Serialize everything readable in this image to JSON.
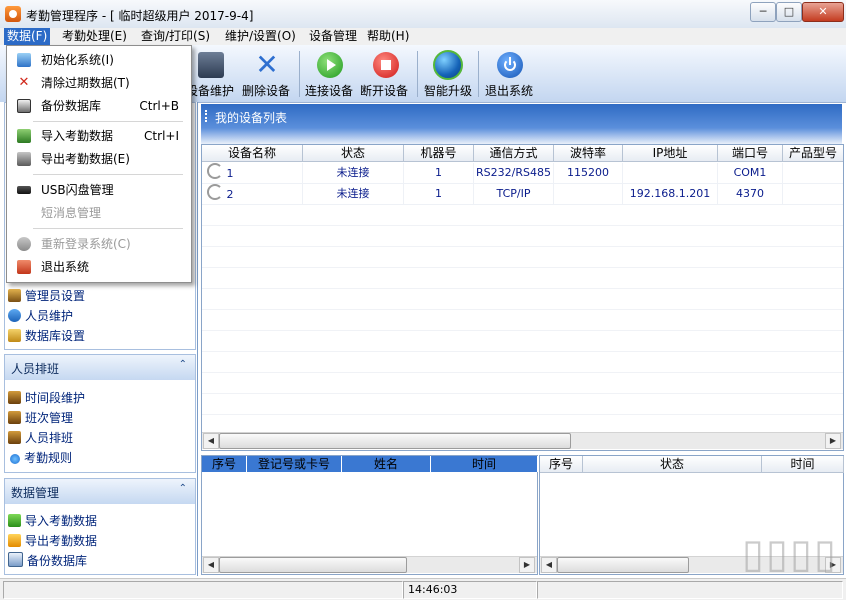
{
  "window": {
    "title": "考勤管理程序 - [ 临时超级用户 2017-9-4]",
    "min_label": "─",
    "max_label": "□",
    "close_label": "✕"
  },
  "menubar": [
    {
      "label": "数据(F)",
      "active": true
    },
    {
      "label": "考勤处理(E)"
    },
    {
      "label": "查询/打印(S)"
    },
    {
      "label": "维护/设置(O)"
    },
    {
      "label": "设备管理"
    },
    {
      "label": "帮助(H)"
    }
  ],
  "toolbar": {
    "buttons": [
      {
        "label": "设备维护",
        "icon": "device-maintenance-icon"
      },
      {
        "label": "删除设备",
        "icon": "delete-x-icon"
      },
      {
        "label": "连接设备",
        "icon": "connect-play-icon"
      },
      {
        "label": "断开设备",
        "icon": "disconnect-stop-icon"
      },
      {
        "label": "智能升级",
        "icon": "globe-upgrade-icon"
      },
      {
        "label": "退出系统",
        "icon": "power-icon"
      }
    ]
  },
  "dropdown": {
    "items": [
      {
        "label": "初始化系统(I)",
        "shortcut": "",
        "icon": "house-icon",
        "disabled": false
      },
      {
        "label": "清除过期数据(T)",
        "shortcut": "",
        "icon": "red-x-icon",
        "disabled": false
      },
      {
        "label": "备份数据库",
        "shortcut": "Ctrl+B",
        "icon": "backup-db-icon",
        "disabled": false
      },
      {
        "label": "导入考勤数据",
        "shortcut": "Ctrl+I",
        "icon": "import-icon",
        "disabled": false
      },
      {
        "label": "导出考勤数据(E)",
        "shortcut": "",
        "icon": "export-icon",
        "disabled": false
      },
      {
        "label": "USB闪盘管理",
        "shortcut": "",
        "icon": "usb-icon",
        "disabled": false
      },
      {
        "label": "短消息管理",
        "shortcut": "",
        "icon": "",
        "disabled": true
      },
      {
        "label": "重新登录系统(C)",
        "shortcut": "",
        "icon": "relogin-icon",
        "disabled": true
      },
      {
        "label": "退出系统",
        "shortcut": "",
        "icon": "exit-icon",
        "disabled": false
      }
    ]
  },
  "leftpanel": {
    "system_items": [
      "管理员设置",
      "人员维护",
      "数据库设置"
    ],
    "group_schedule": {
      "title": "人员排班",
      "collapse": "⌃",
      "items": [
        "时间段维护",
        "班次管理",
        "人员排班",
        "考勤规则"
      ]
    },
    "group_data": {
      "title": "数据管理",
      "collapse": "⌃",
      "items": [
        "导入考勤数据",
        "导出考勤数据",
        "备份数据库"
      ]
    }
  },
  "devices": {
    "title": "我的设备列表",
    "columns": [
      "设备名称",
      "状态",
      "机器号",
      "通信方式",
      "波特率",
      "IP地址",
      "端口号",
      "产品型号"
    ],
    "rows": [
      [
        "1",
        "未连接",
        "1",
        "RS232/RS485",
        "115200",
        "",
        "COM1",
        ""
      ],
      [
        "2",
        "未连接",
        "1",
        "TCP/IP",
        "",
        "192.168.1.201",
        "4370",
        ""
      ]
    ]
  },
  "log_left": {
    "columns": [
      "序号",
      "登记号或卡号",
      "姓名",
      "时间"
    ]
  },
  "log_right": {
    "columns": [
      "序号",
      "状态",
      "时间"
    ]
  },
  "statusbar": {
    "time": "14:46:03"
  },
  "colors": {
    "accent": "#2f6bc4",
    "menu_highlight": "#2c6bc7"
  }
}
